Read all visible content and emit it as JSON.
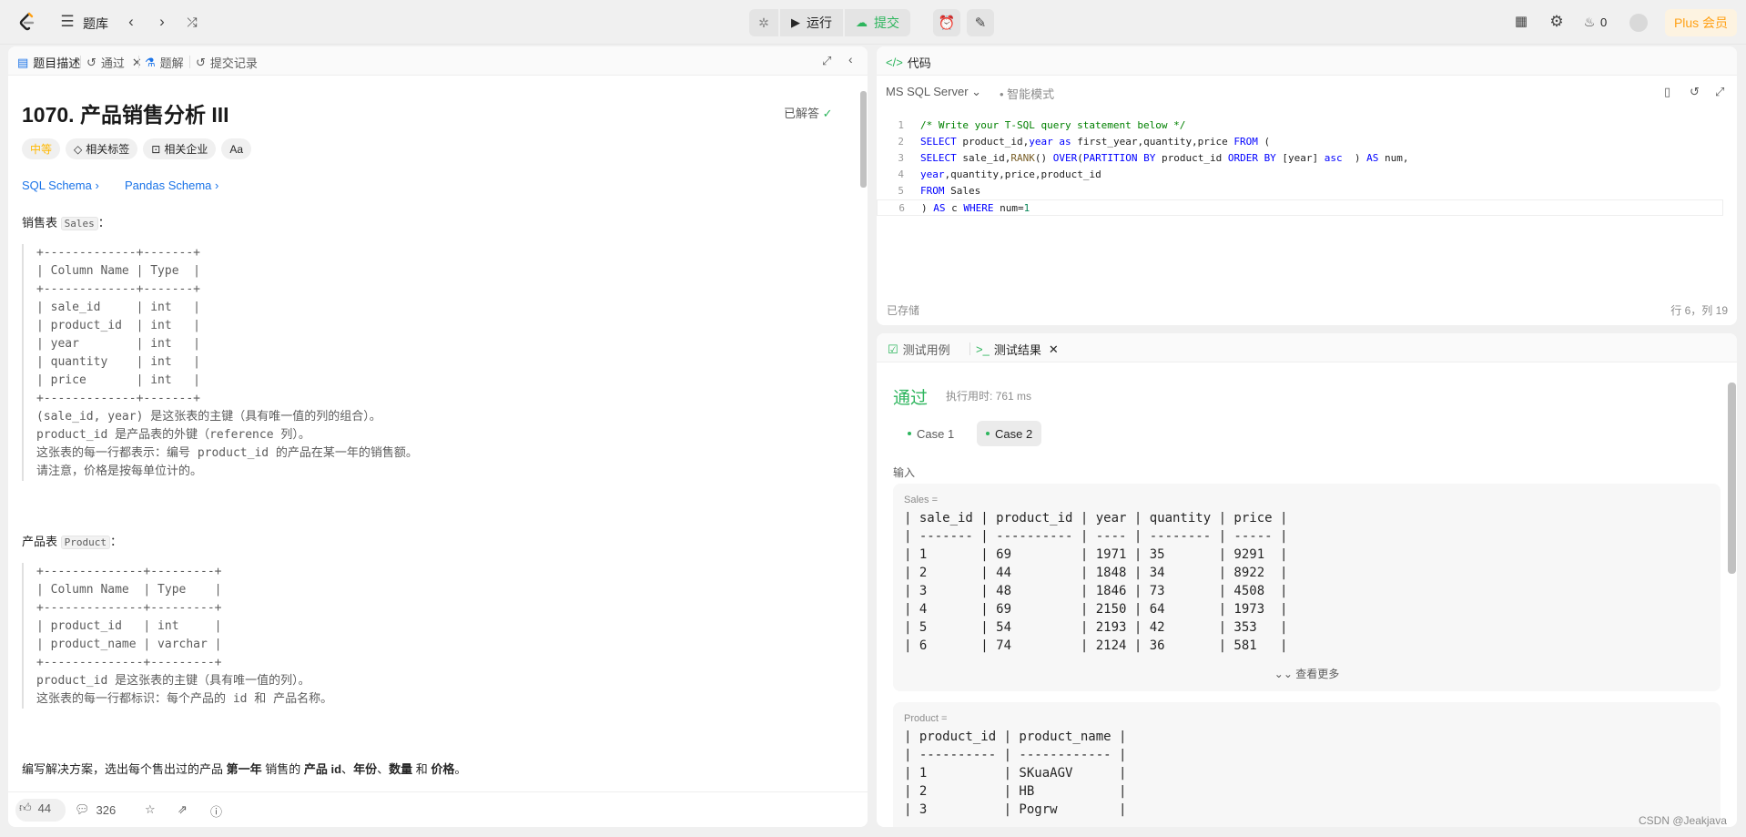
{
  "topbar": {
    "problem_list": "题库",
    "run": "运行",
    "submit": "提交",
    "streak": "0",
    "plus": "Plus 会员"
  },
  "left": {
    "tabs": [
      "题目描述",
      "通过",
      "题解",
      "提交记录"
    ],
    "title": "1070. 产品销售分析 III",
    "solved": "已解答",
    "tags": [
      "中等",
      "相关标签",
      "相关企业",
      "Aa"
    ],
    "schemas": [
      "SQL Schema",
      "Pandas Schema"
    ],
    "sales_intro": "销售表",
    "sales_name": "Sales",
    "sales_block": "+-------------+-------+\n| Column Name | Type  |\n+-------------+-------+\n| sale_id     | int   |\n| product_id  | int   |\n| year        | int   |\n| quantity    | int   |\n| price       | int   |\n+-------------+-------+",
    "sales_notes": [
      "(sale_id, year) 是这张表的主键（具有唯一值的列的组合）。",
      "product_id 是产品表的外键（reference 列）。",
      "这张表的每一行都表示：编号 product_id 的产品在某一年的销售额。",
      "请注意，价格是按每单位计的。"
    ],
    "product_intro": "产品表",
    "product_name": "Product",
    "product_block": "+--------------+---------+\n| Column Name  | Type    |\n+--------------+---------+\n| product_id   | int     |\n| product_name | varchar |\n+--------------+---------+",
    "product_notes": [
      "product_id 是这张表的主键（具有唯一值的列）。",
      "这张表的每一行都标识：每个产品的 id 和 产品名称。"
    ],
    "task_parts": [
      "编写解决方案，选出每个售出过的产品 ",
      "第一年",
      " 销售的 ",
      "产品 id",
      "、",
      "年份",
      "、",
      "数量",
      " 和 ",
      "价格",
      "。"
    ],
    "likes": "44",
    "comments": "326"
  },
  "code": {
    "tab": "代码",
    "lang": "MS SQL Server",
    "smart": "智能模式",
    "saved": "已存储",
    "pos": "行 6，列 19",
    "lines": [
      "1",
      "2",
      "3",
      "4",
      "5",
      "6"
    ]
  },
  "result": {
    "tabs": [
      "测试用例",
      "测试结果"
    ],
    "status": "通过",
    "exec": "执行用时: 761 ms",
    "cases": [
      "Case 1",
      "Case 2"
    ],
    "input_label": "输入",
    "sales_label": "Sales =",
    "sales_rows": [
      "| sale_id | product_id | year | quantity | price |",
      "| ------- | ---------- | ---- | -------- | ----- |",
      "| 1       | 69         | 1971 | 35       | 9291  |",
      "| 2       | 44         | 1848 | 34       | 8922  |",
      "| 3       | 48         | 1846 | 73       | 4508  |",
      "| 4       | 69         | 2150 | 64       | 1973  |",
      "| 5       | 54         | 2193 | 42       | 353   |",
      "| 6       | 74         | 2124 | 36       | 581   |"
    ],
    "more": "查看更多",
    "product_label": "Product =",
    "product_rows": [
      "| product_id | product_name |",
      "| ---------- | ------------ |",
      "| 1          | SKuaAGV      |",
      "| 2          | HB           |",
      "| 3          | Pogrw        |"
    ]
  },
  "watermark": "CSDN @Jeakjava"
}
